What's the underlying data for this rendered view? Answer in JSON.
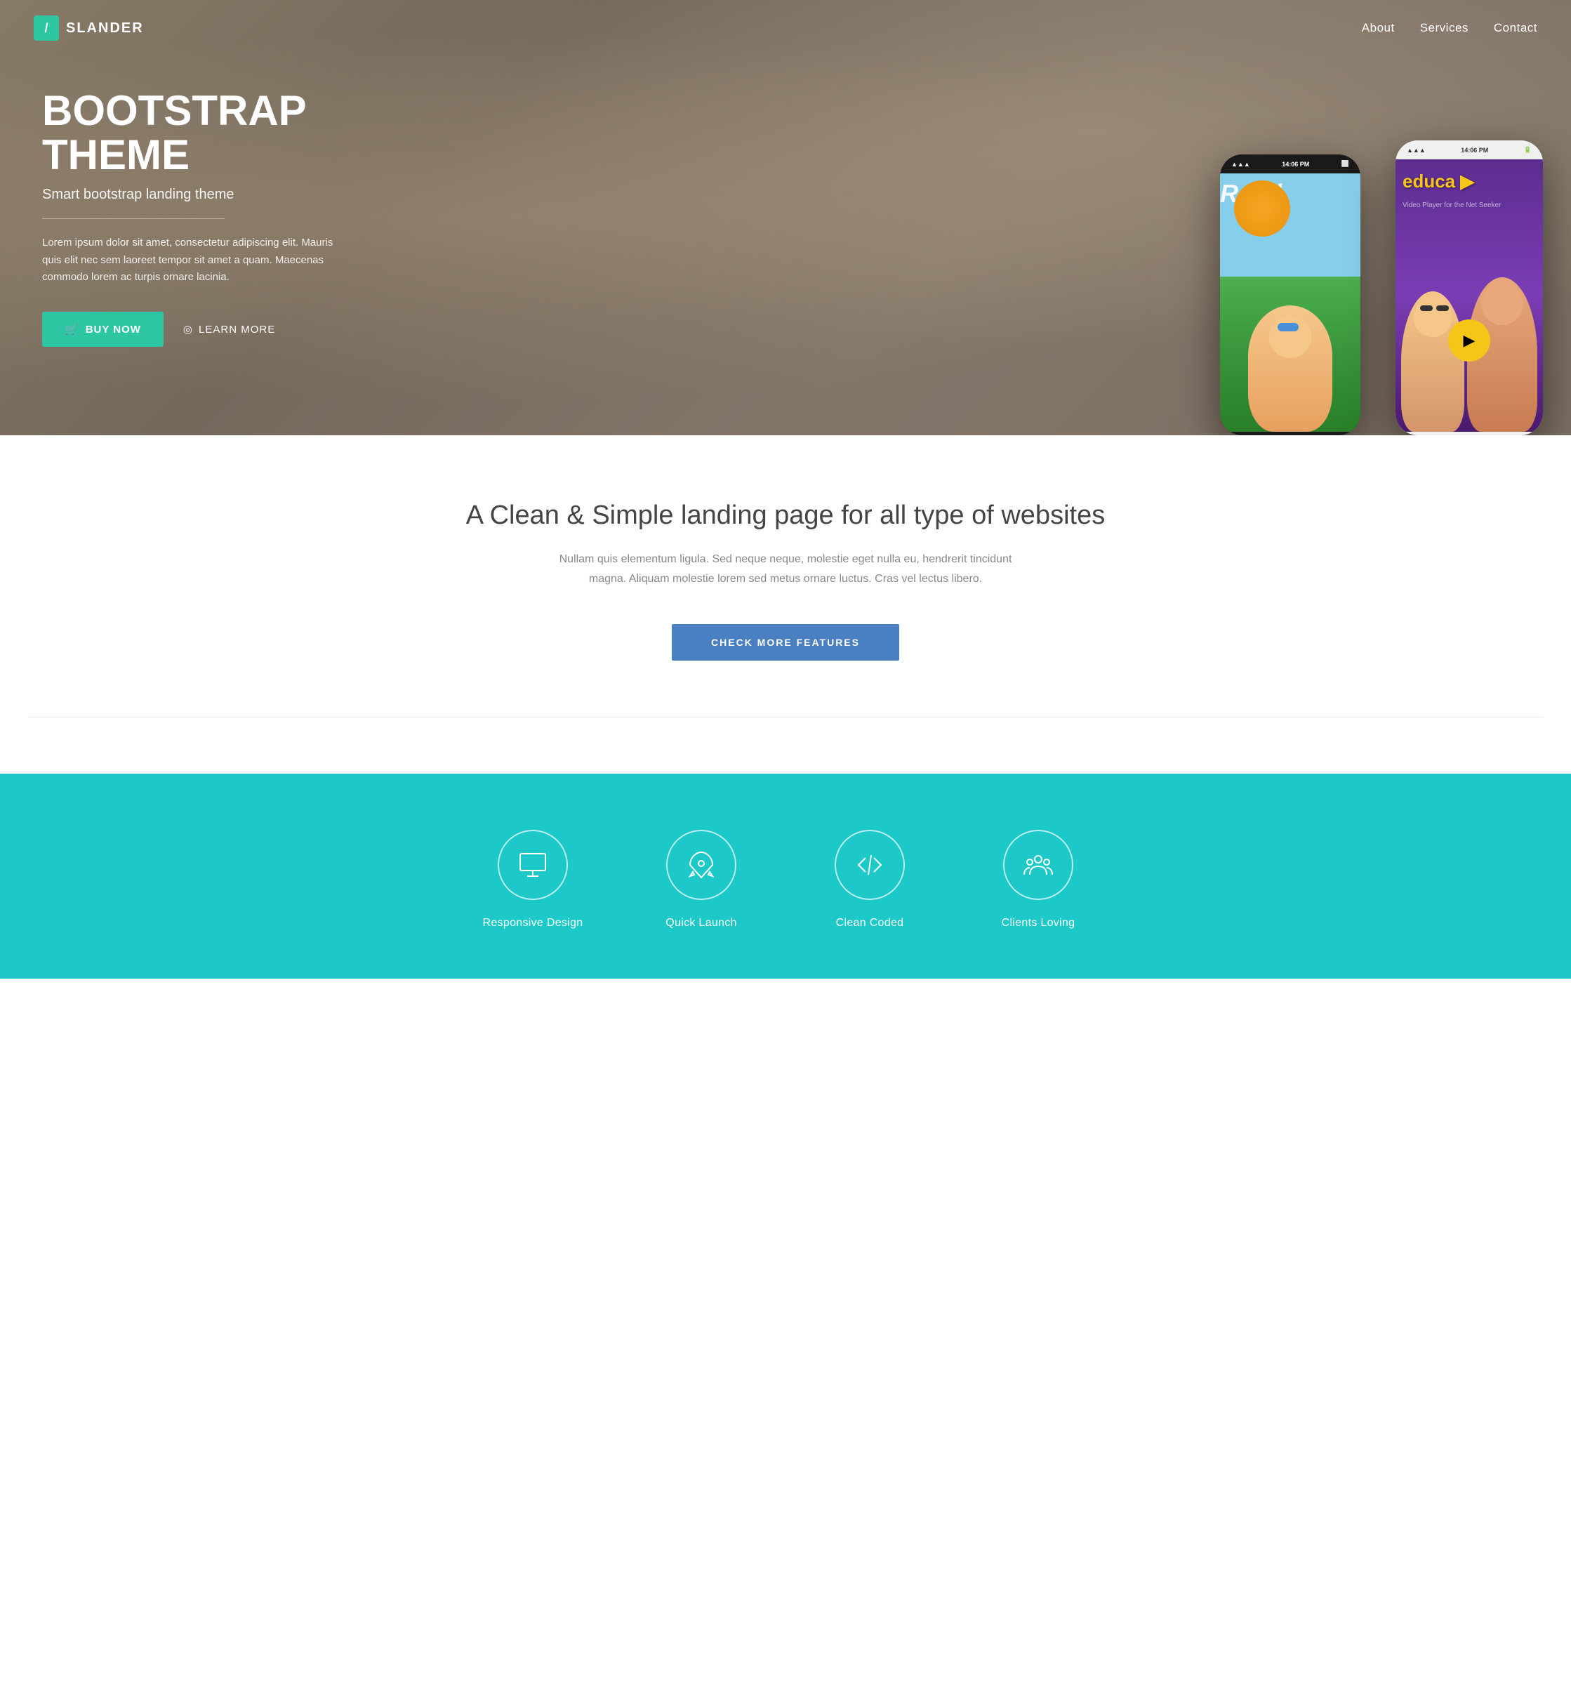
{
  "nav": {
    "logo_icon": "/",
    "logo_text": "SLANDER",
    "links": [
      {
        "id": "about",
        "label": "About"
      },
      {
        "id": "services",
        "label": "Services"
      },
      {
        "id": "contact",
        "label": "Contact"
      }
    ]
  },
  "hero": {
    "title": "BOOTSTRAP\nTHEME",
    "subtitle": "Smart bootstrap landing theme",
    "description": "Lorem ipsum dolor sit amet, consectetur adipiscing elit. Mauris quis elit nec sem laoreet tempor sit amet a quam. Maecenas commodo lorem ac turpis ornare lacinia.",
    "btn_buy": "BUY NOW",
    "btn_learn": "LEARN MORE"
  },
  "mid": {
    "title": "A Clean & Simple landing page for all type of websites",
    "description": "Nullam quis elementum ligula. Sed neque neque, molestie eget nulla eu, hendrerit tincidunt magna.\nAliquam molestie lorem sed metus ornare luctus. Cras vel lectus libero.",
    "btn_check": "CHECK MORE FEATURES"
  },
  "features": {
    "items": [
      {
        "id": "responsive",
        "label": "Responsive Design",
        "icon": "monitor"
      },
      {
        "id": "launch",
        "label": "Quick Launch",
        "icon": "rocket"
      },
      {
        "id": "coded",
        "label": "Clean Coded",
        "icon": "code"
      },
      {
        "id": "clients",
        "label": "Clients Loving",
        "icon": "team"
      }
    ]
  },
  "phones": {
    "black": {
      "time": "14:06 PM",
      "app_title": "Read"
    },
    "white": {
      "time": "14:06 PM",
      "app_title": "educa"
    }
  }
}
